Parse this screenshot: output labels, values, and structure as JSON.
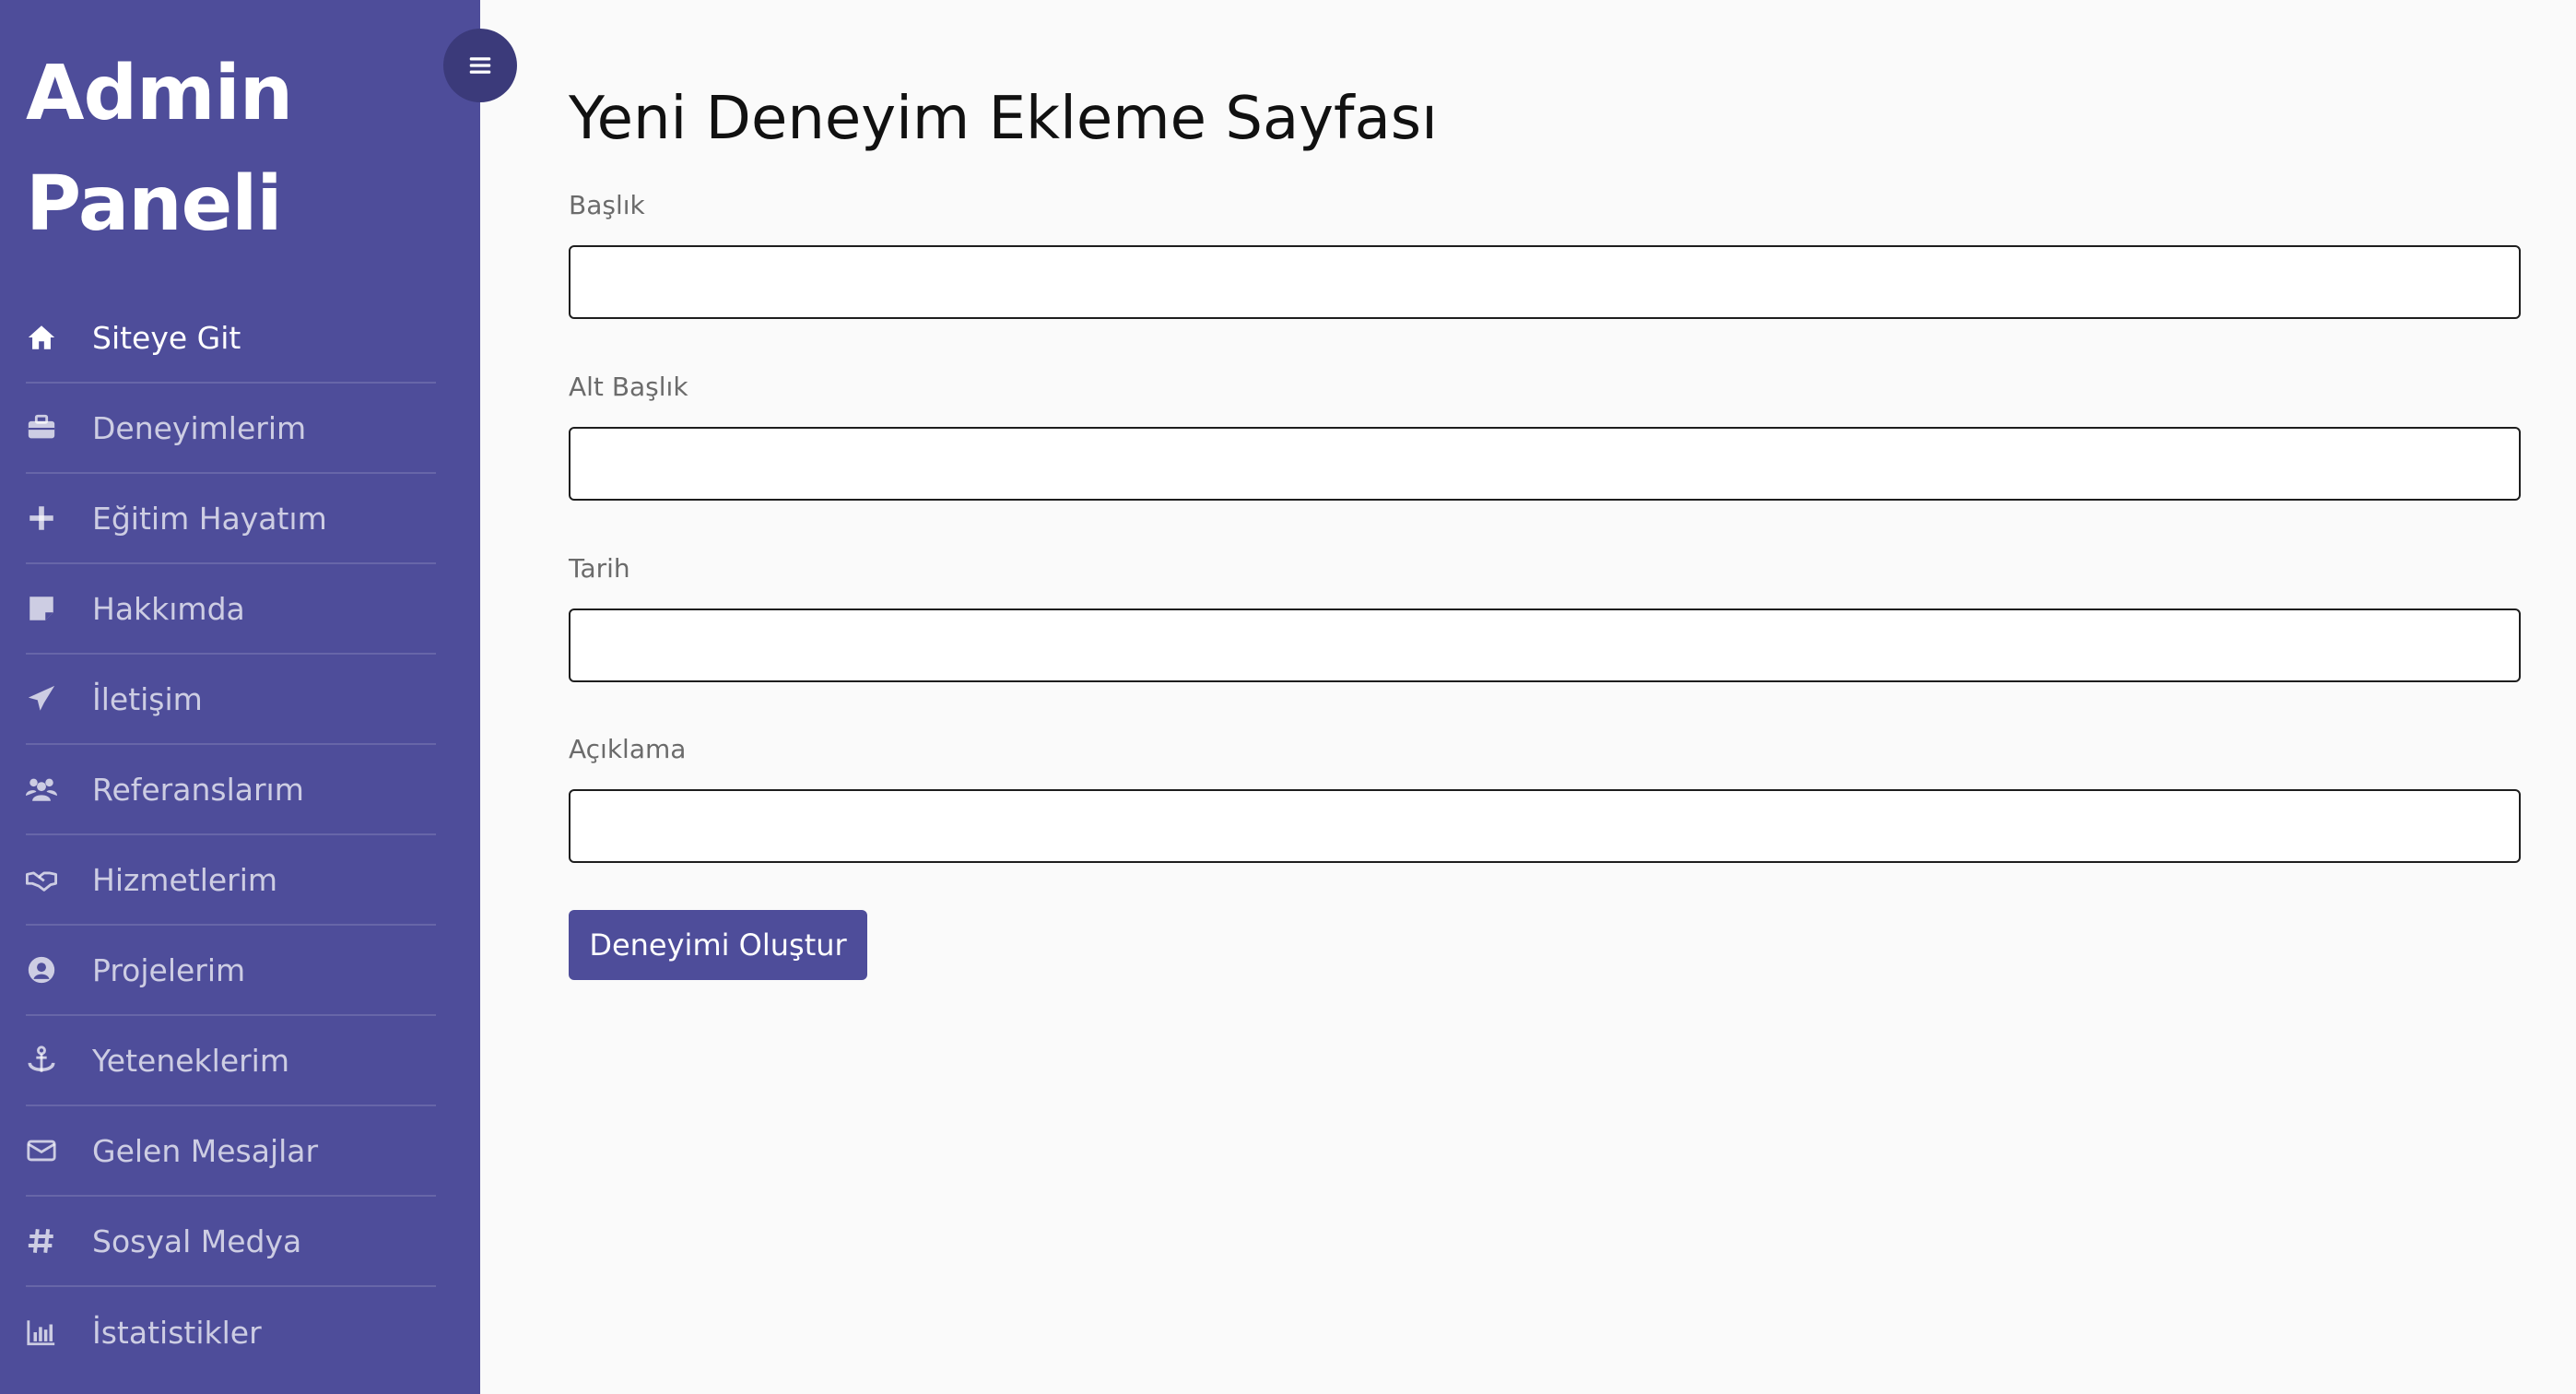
{
  "sidebar": {
    "brand_line1": "Admin",
    "brand_line2": "Paneli",
    "accent_color": "#4e4d9a",
    "items": [
      {
        "label": "Siteye Git",
        "icon": "home-icon"
      },
      {
        "label": "Deneyimlerim",
        "icon": "briefcase-icon"
      },
      {
        "label": "Eğitim Hayatım",
        "icon": "plus-icon"
      },
      {
        "label": "Hakkımda",
        "icon": "sticky-note-icon"
      },
      {
        "label": "İletişim",
        "icon": "paper-plane-icon"
      },
      {
        "label": "Referanslarım",
        "icon": "users-icon"
      },
      {
        "label": "Hizmetlerim",
        "icon": "handshake-icon"
      },
      {
        "label": "Projelerim",
        "icon": "user-circle-icon"
      },
      {
        "label": "Yeteneklerim",
        "icon": "anchor-icon"
      },
      {
        "label": "Gelen Mesajlar",
        "icon": "envelope-icon"
      },
      {
        "label": "Sosyal Medya",
        "icon": "hashtag-icon"
      },
      {
        "label": "İstatistikler",
        "icon": "bar-chart-icon"
      }
    ]
  },
  "header": {
    "toggle_icon": "hamburger-menu-icon"
  },
  "form": {
    "title": "Yeni Deneyim Ekleme Sayfası",
    "fields": [
      {
        "label": "Başlık",
        "value": ""
      },
      {
        "label": "Alt Başlık",
        "value": ""
      },
      {
        "label": "Tarih",
        "value": ""
      },
      {
        "label": "Açıklama",
        "value": ""
      }
    ],
    "submit_label": "Deneyimi Oluştur"
  }
}
